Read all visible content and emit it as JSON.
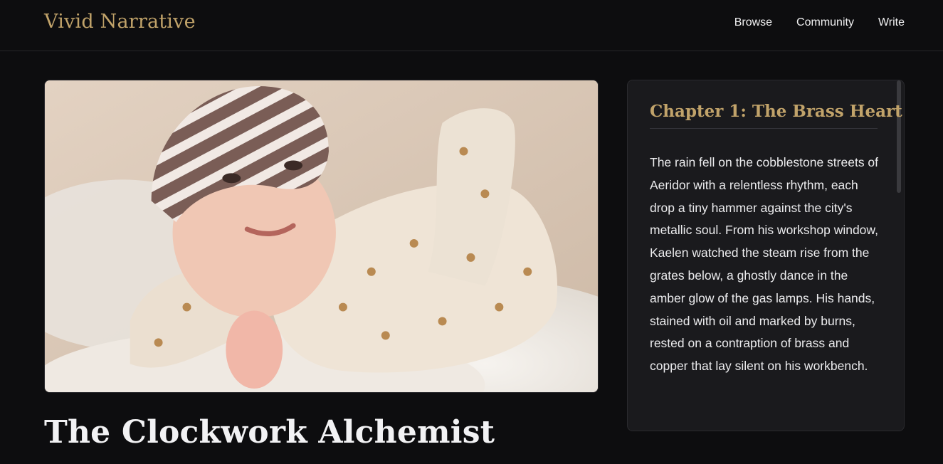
{
  "header": {
    "brand": "Vivid Narrative",
    "nav": [
      {
        "label": "Browse"
      },
      {
        "label": "Community"
      },
      {
        "label": "Write"
      }
    ]
  },
  "story": {
    "title": "The Clockwork Alchemist"
  },
  "chapter": {
    "title": "Chapter 1: The Brass Heart",
    "body": "The rain fell on the cobblestone streets of Aeridor with a relentless rhythm, each drop a tiny hammer against the city's metallic soul. From his workshop window, Kaelen watched the steam rise from the grates below, a ghostly dance in the amber glow of the gas lamps. His hands, stained with oil and marked by burns, rested on a contraption of brass and copper that lay silent on his workbench."
  },
  "colors": {
    "background": "#0d0d0f",
    "accent": "#c1a36a",
    "panel": "#1a1a1d"
  }
}
